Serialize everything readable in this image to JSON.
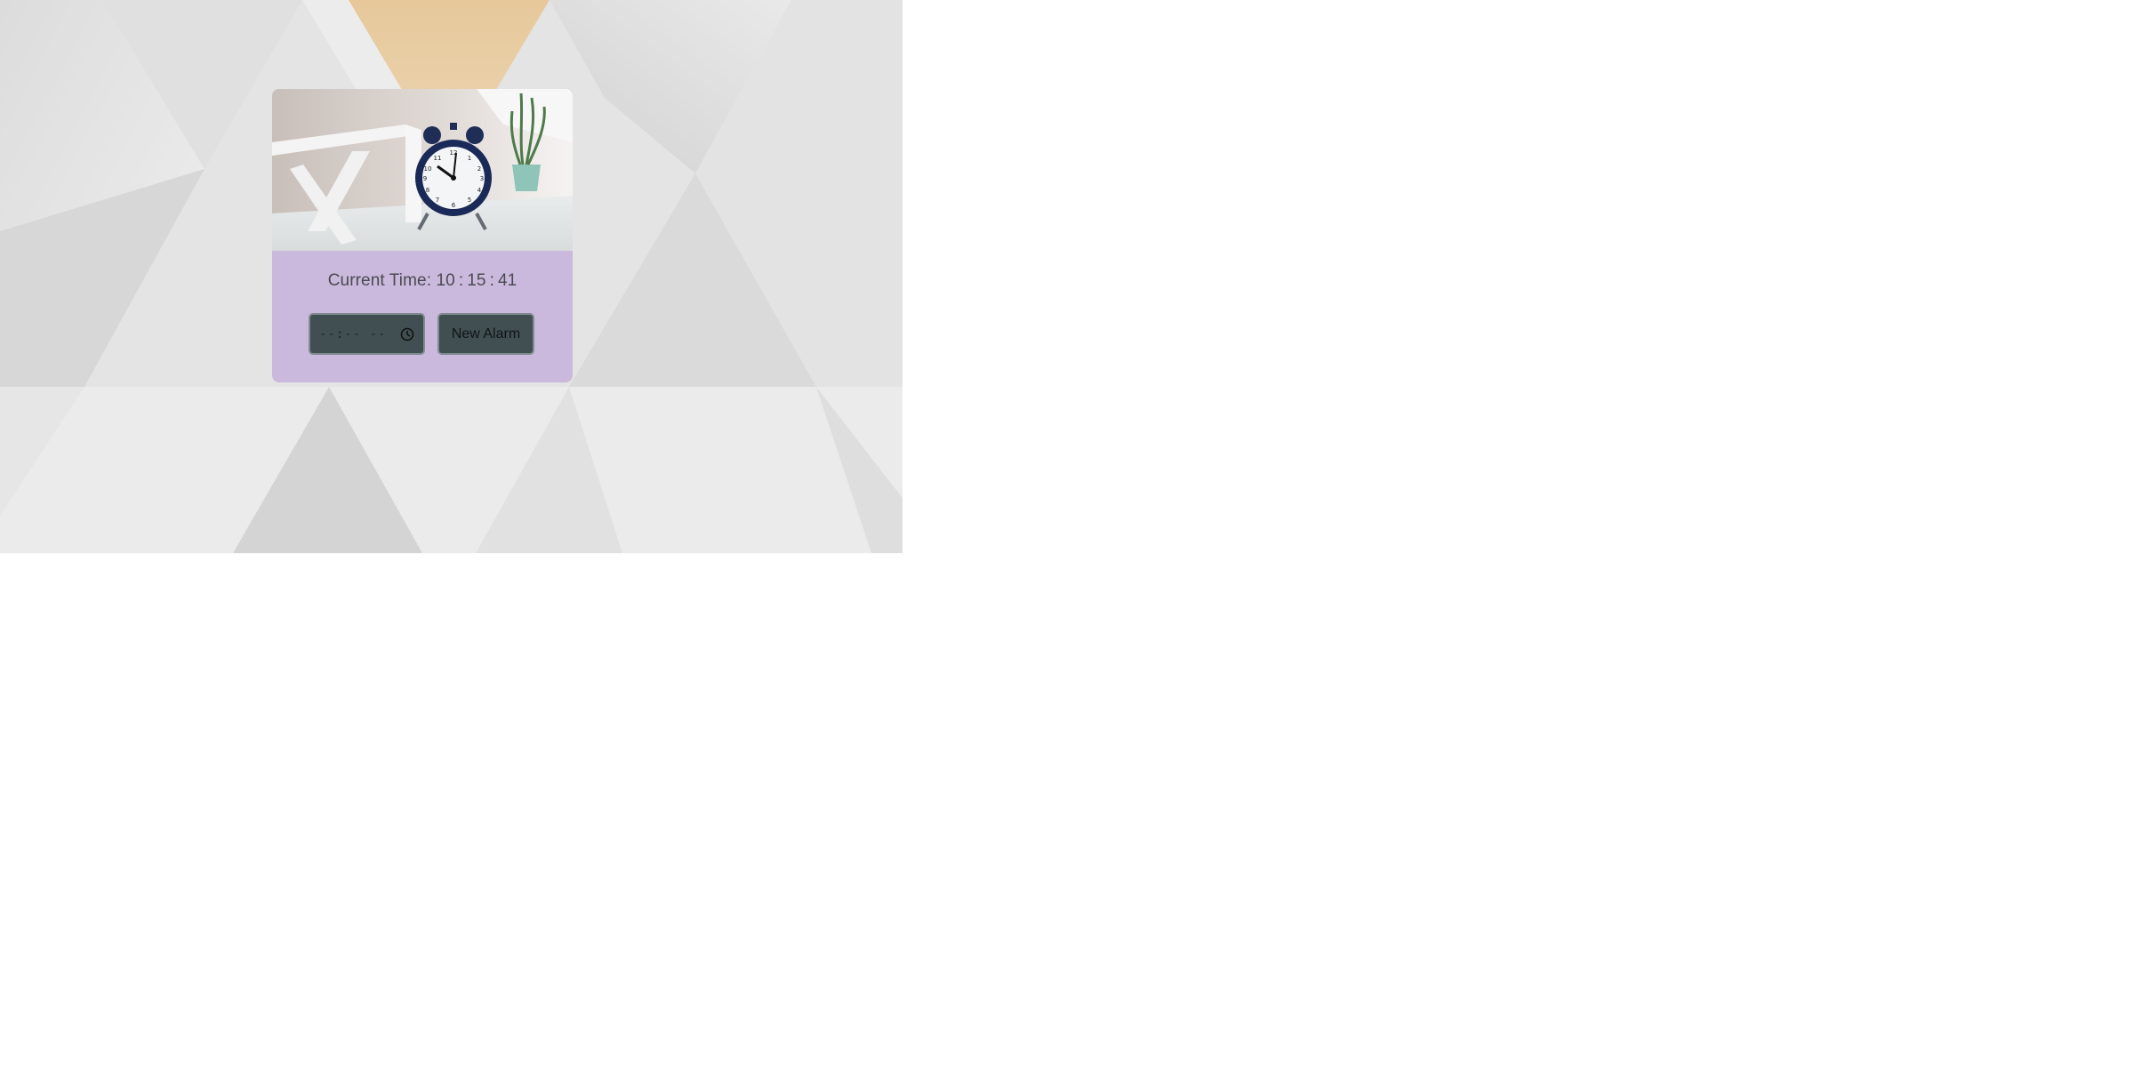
{
  "clock": {
    "label": "Current Time:",
    "hours": "10",
    "minutes": "15",
    "seconds": "41",
    "separator": ":"
  },
  "alarm": {
    "time_value": "--:-- --",
    "button_label": "New Alarm"
  },
  "colors": {
    "card_background": "#cab9dc",
    "control_background": "#424f52",
    "text": "#4a4a52"
  },
  "icons": {
    "time_picker": "clock-icon"
  }
}
